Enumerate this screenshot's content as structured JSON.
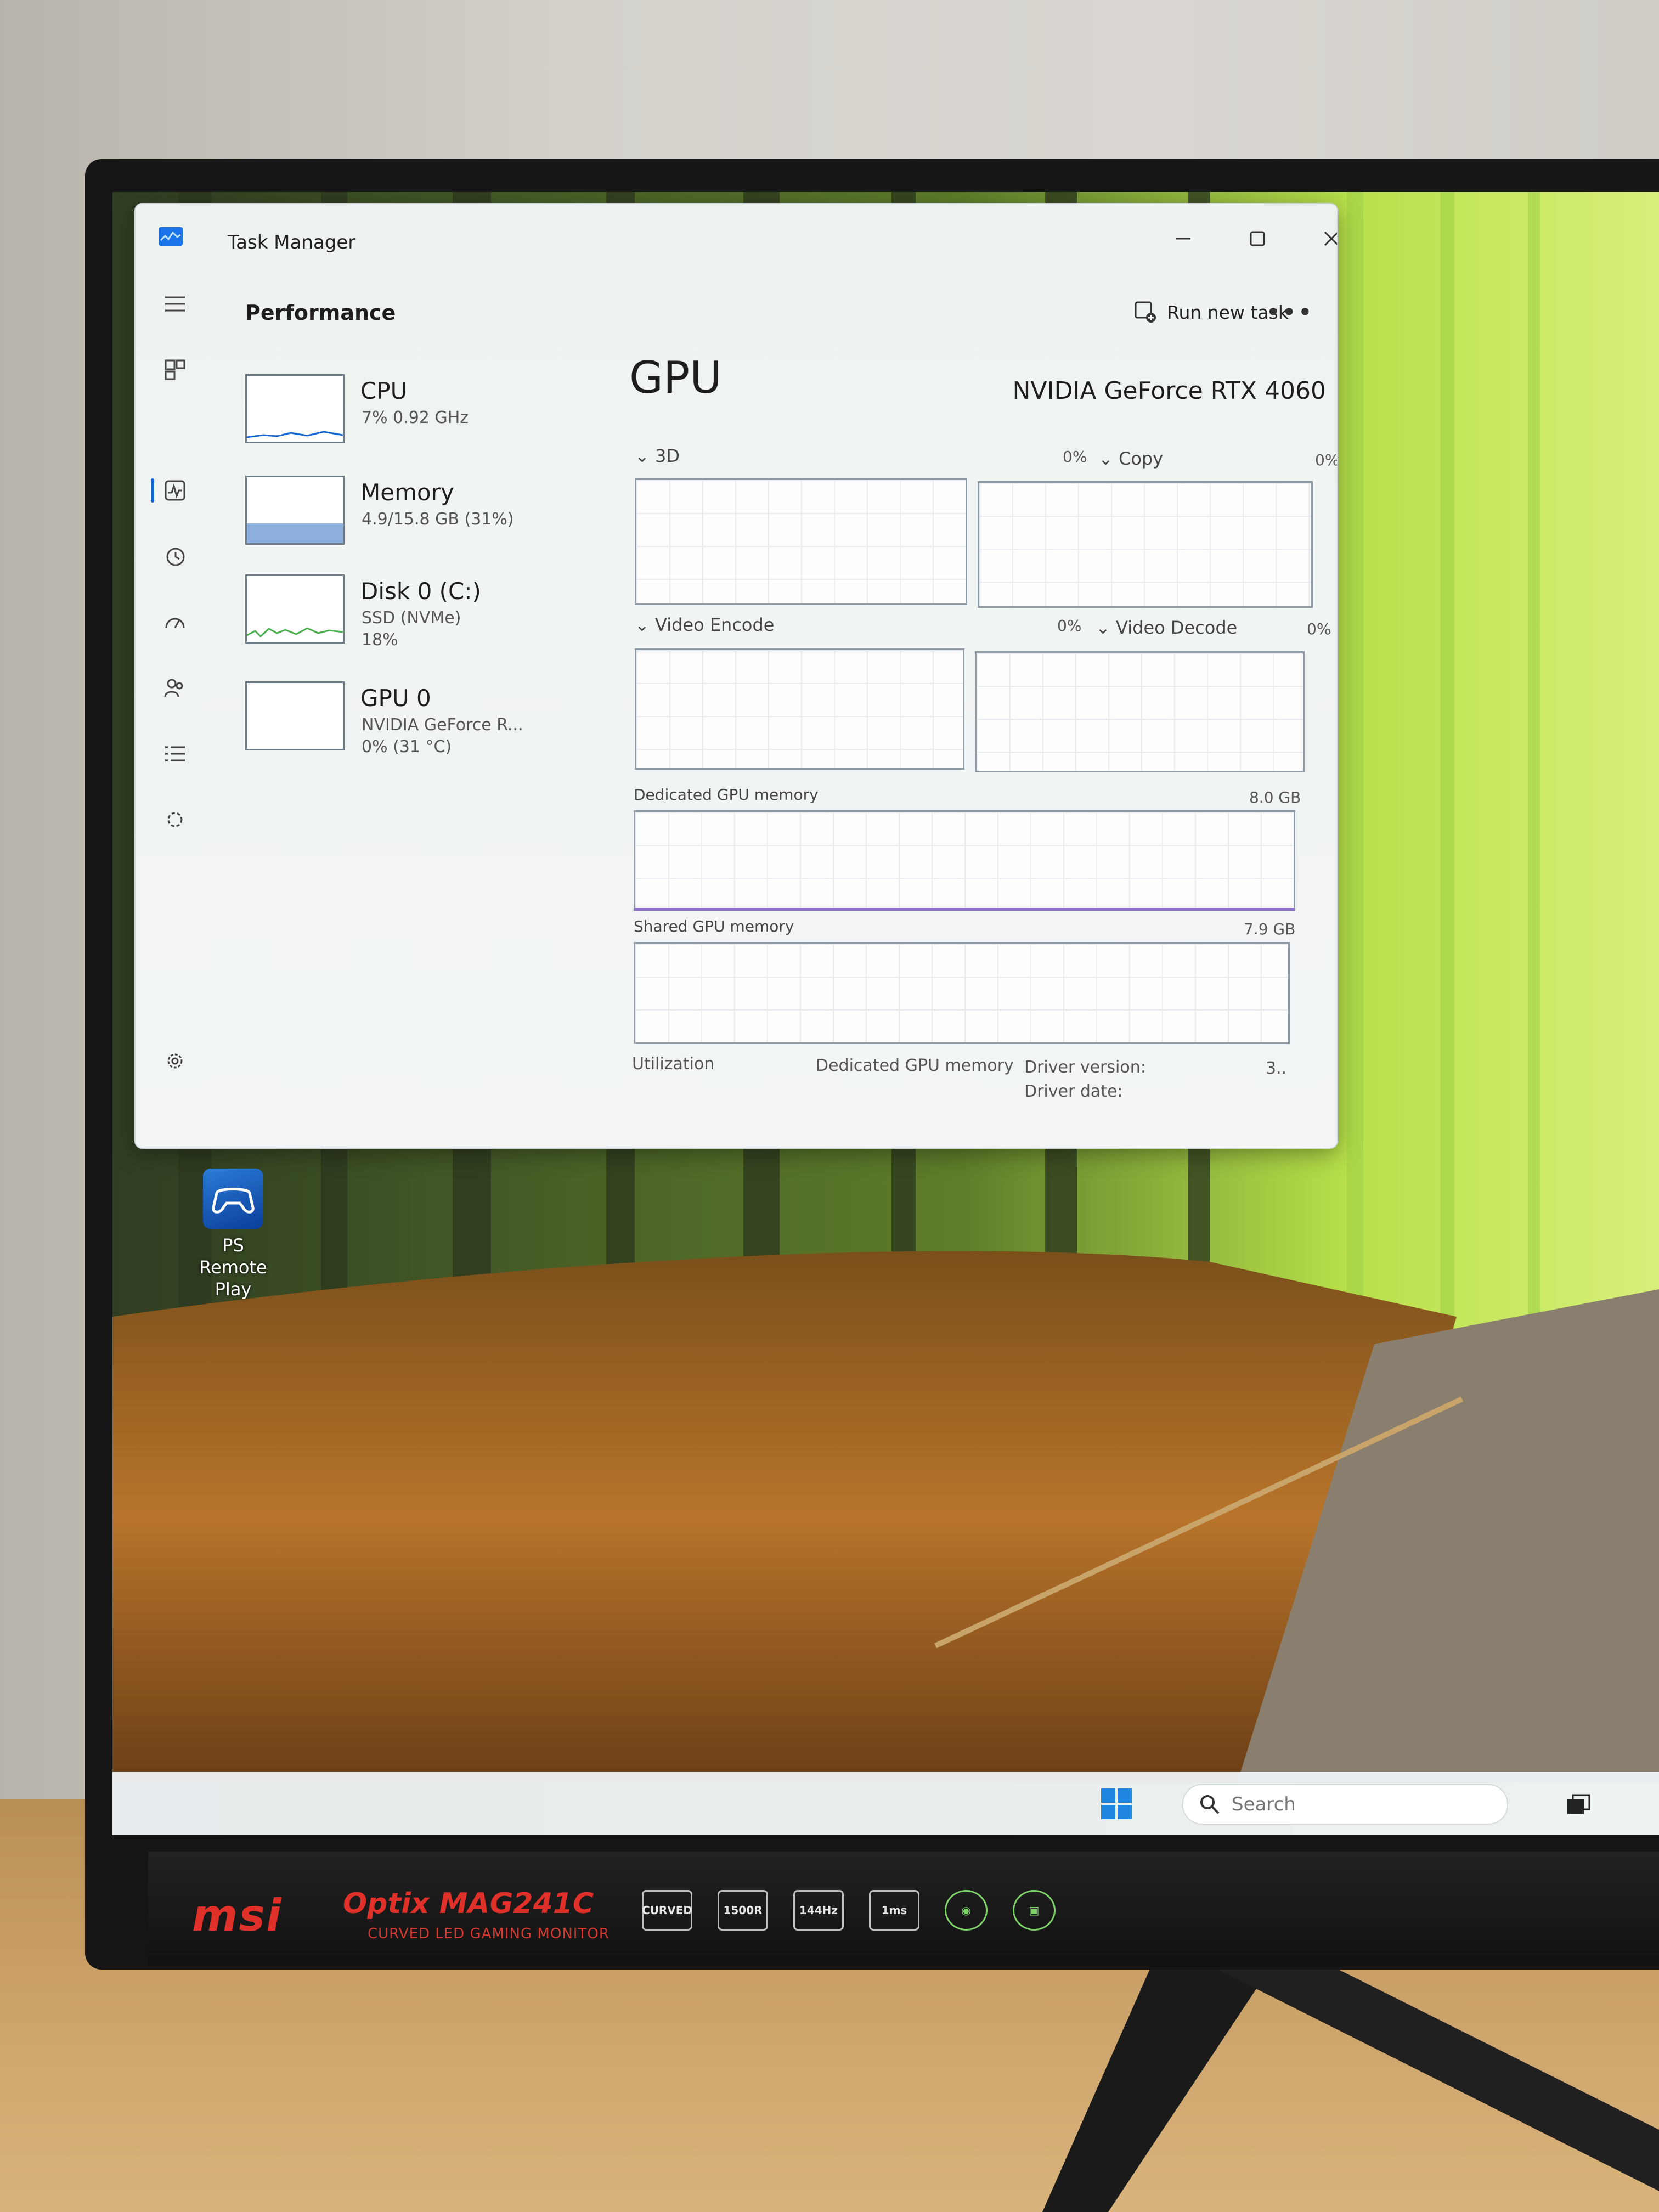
{
  "task_manager": {
    "title": "Task Manager",
    "page_title": "Performance",
    "run_new_task": "Run new task",
    "more": "•••",
    "side_items": [
      {
        "name": "CPU",
        "sub1": "7% 0.92 GHz",
        "sub2": ""
      },
      {
        "name": "Memory",
        "sub1": "4.9/15.8 GB (31%)",
        "sub2": ""
      },
      {
        "name": "Disk 0 (C:)",
        "sub1": "SSD (NVMe)",
        "sub2": "18%"
      },
      {
        "name": "GPU 0",
        "sub1": "NVIDIA GeForce R...",
        "sub2": "0% (31 °C)"
      }
    ],
    "gpu": {
      "heading": "GPU",
      "model": "NVIDIA GeForce RTX 4060",
      "engines": [
        {
          "label": "3D",
          "pct": "0%"
        },
        {
          "label": "Copy",
          "pct": "0%"
        },
        {
          "label": "Video Encode",
          "pct": "0%"
        },
        {
          "label": "Video Decode",
          "pct": "0%"
        }
      ],
      "dedicated_label": "Dedicated GPU memory",
      "dedicated_total": "8.0 GB",
      "shared_label": "Shared GPU memory",
      "shared_total": "7.9 GB",
      "stats": {
        "utilization": "Utilization",
        "dedicated": "Dedicated GPU memory",
        "driver_version": "Driver version:",
        "driver_version_val": "3..",
        "driver_date": "Driver date:"
      }
    }
  },
  "desktop": {
    "icon_label_1": "PS Remote",
    "icon_label_2": "Play"
  },
  "taskbar": {
    "search_placeholder": "Search"
  },
  "monitor": {
    "brand": "msi",
    "model": "Optix MAG241C",
    "subtitle": "CURVED LED GAMING MONITOR",
    "badges": [
      "CURVED",
      "1500R",
      "144Hz",
      "1ms"
    ]
  },
  "colors": {
    "accent": "#1667d6",
    "brand_red": "#e0302a",
    "disk_graph": "#4caf50",
    "memory_fill": "#8fb0de"
  }
}
